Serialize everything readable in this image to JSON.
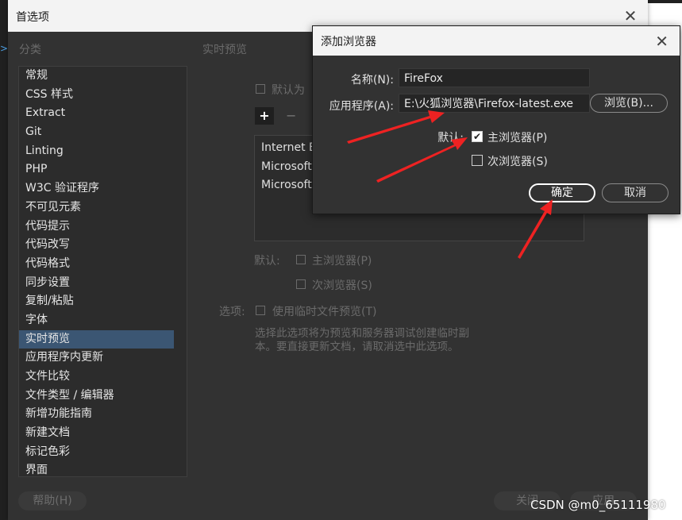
{
  "preferences": {
    "title": "首选项",
    "category_header": "分类",
    "section_header": "实时预览",
    "categories": [
      "常规",
      "CSS 样式",
      "Extract",
      "Git",
      "Linting",
      "PHP",
      "W3C 验证程序",
      "不可见元素",
      "代码提示",
      "代码改写",
      "代码格式",
      "同步设置",
      "复制/粘贴",
      "字体",
      "实时预览",
      "应用程序内更新",
      "文件比较",
      "文件类型 / 编辑器",
      "新增功能指南",
      "新建文档",
      "标记色彩",
      "界面"
    ],
    "selected_category": "实时预览",
    "default_checkbox_label": "默认为",
    "add_button": "+",
    "remove_button": "−",
    "browsers": [
      "Internet Ex",
      "Microsoft E",
      "MicrosoftE"
    ],
    "default_label": "默认:",
    "primary_browser": "主浏览器(P)",
    "secondary_browser": "次浏览器(S)",
    "options_label": "选项:",
    "temp_preview": "使用临时文件预览(T)",
    "description_line1": "选择此选项将为预览和服务器调试创建临时副",
    "description_line2": "本。要直接更新文档，请取消选中此选项。",
    "help_button": "帮助(H)",
    "close_button": "关闭",
    "apply_button": "应用"
  },
  "add_browser_dialog": {
    "title": "添加浏览器",
    "name_label": "名称(N):",
    "name_value": "FireFox",
    "app_label": "应用程序(A):",
    "app_value": "E:\\火狐浏览器\\Firefox-latest.exe",
    "browse_button": "浏览(B)...",
    "default_label": "默认:",
    "primary_label": "主浏览器(P)",
    "primary_checked": true,
    "secondary_label": "次浏览器(S)",
    "secondary_checked": false,
    "ok_button": "确定",
    "cancel_button": "取消",
    "check_mark": "✔"
  },
  "watermark": "CSDN @m0_65111980",
  "edge_glyph": ">",
  "colors": {
    "panel_bg": "#323232",
    "titlebar_bg": "#f3f3f3",
    "selection": "#3b5673",
    "annotation_arrow": "#ee2222"
  }
}
